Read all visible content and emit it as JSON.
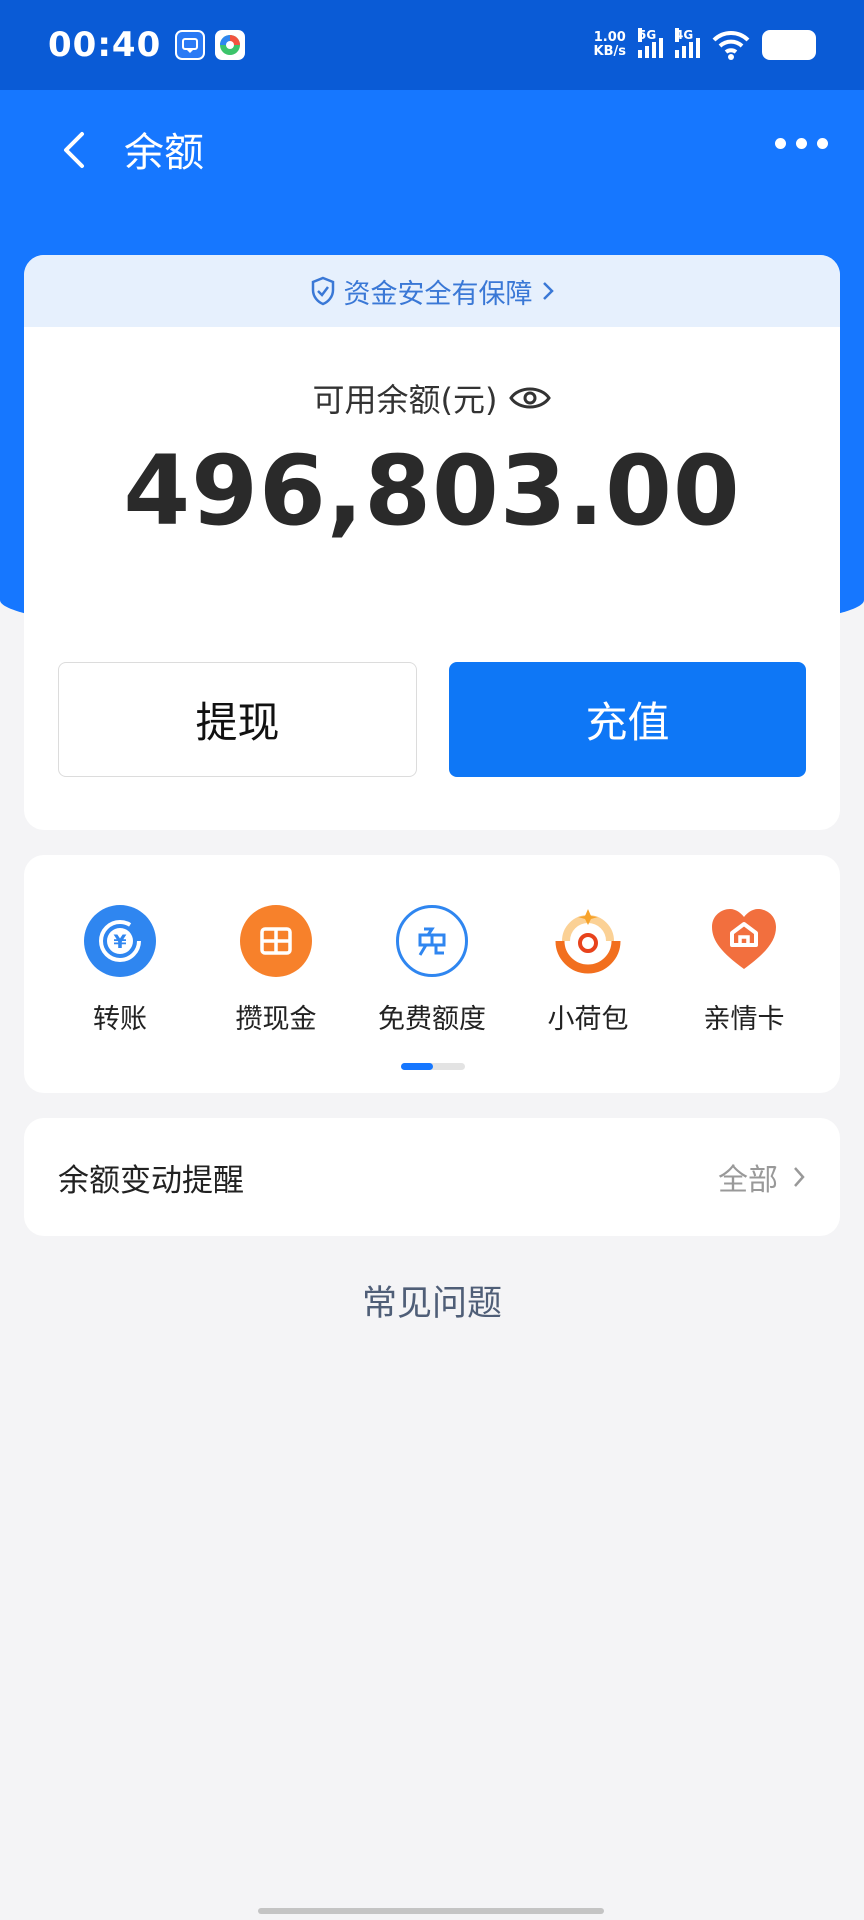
{
  "status_bar": {
    "time": "00:40",
    "net_speed_value": "1.00",
    "net_speed_unit": "KB/s",
    "sim1_label": "5G",
    "sim2_label": "4G"
  },
  "nav": {
    "title": "余额"
  },
  "balance_card": {
    "guarantee_text": "资金安全有保障",
    "label": "可用余额(元)",
    "amount": "496,803.00",
    "withdraw_label": "提现",
    "recharge_label": "充值"
  },
  "shortcuts": [
    {
      "label": "转账",
      "icon": "transfer-icon",
      "color": "#2f86f0"
    },
    {
      "label": "攒现金",
      "icon": "save-cash-icon",
      "color": "#f7812b"
    },
    {
      "label": "免费额度",
      "icon": "free-quota-icon",
      "color": "#2f86f0"
    },
    {
      "label": "小荷包",
      "icon": "small-purse-icon",
      "color": "#f26f1e"
    },
    {
      "label": "亲情卡",
      "icon": "family-card-icon",
      "color": "#f26f3e"
    }
  ],
  "shortcut_pager": {
    "active_page": 1,
    "total_pages": 2
  },
  "notice": {
    "title": "余额变动提醒",
    "all_label": "全部"
  },
  "faq": {
    "label": "常见问题"
  }
}
